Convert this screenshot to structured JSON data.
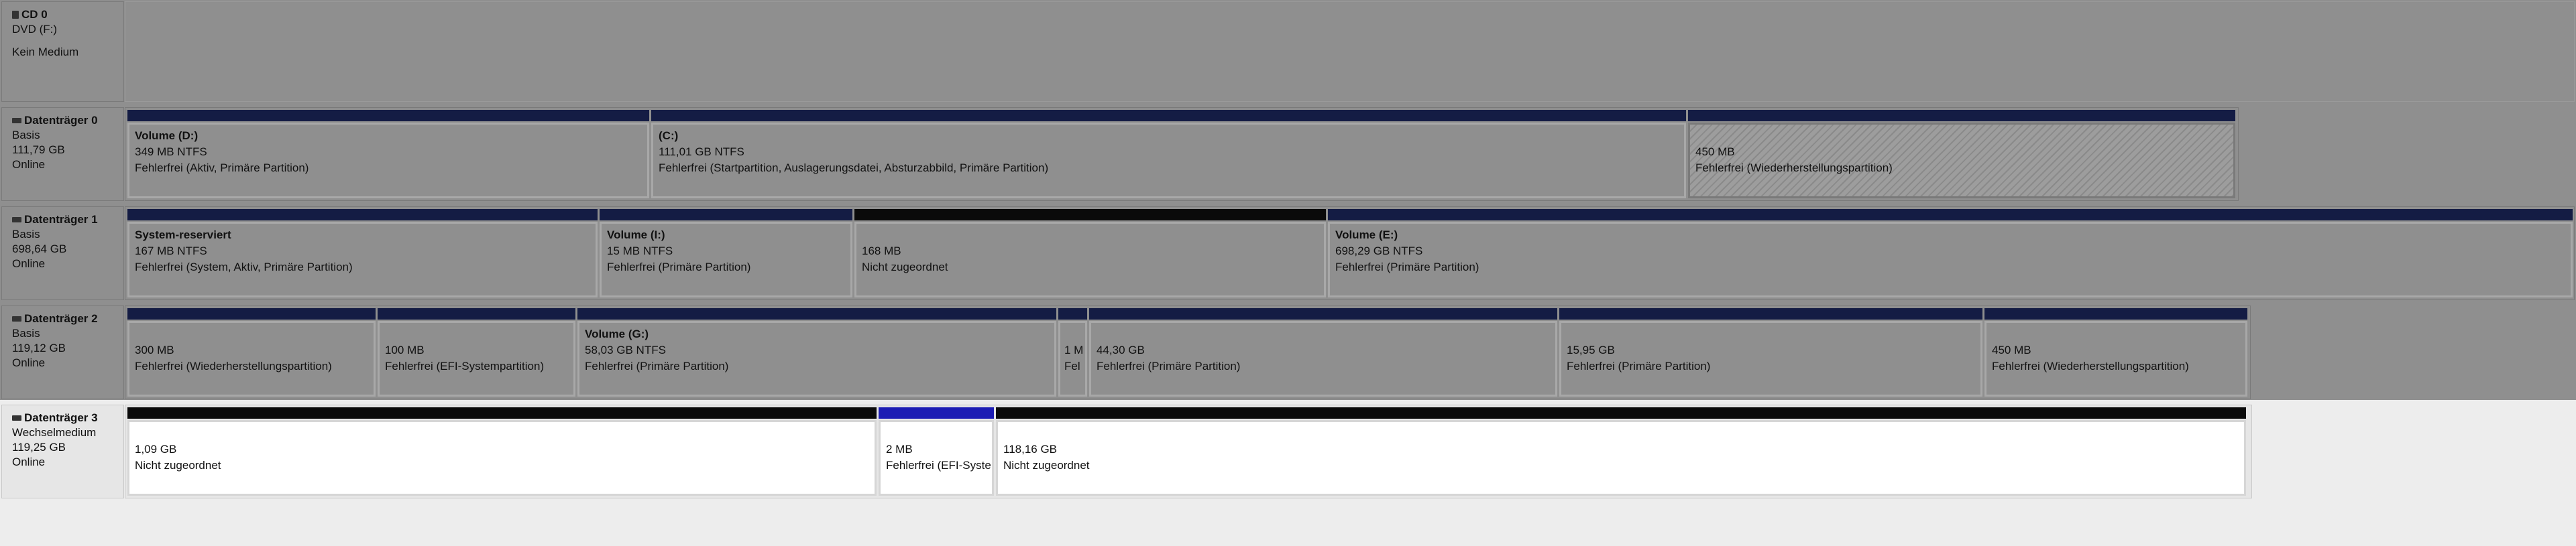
{
  "colors": {
    "primary_bar": "#141c44",
    "unallocated_bar": "#0a0a0a",
    "efi_bar": "#1d1db4"
  },
  "cd0": {
    "name": "CD 0",
    "type": "DVD (F:)",
    "status": "Kein Medium"
  },
  "disks": [
    {
      "name": "Datenträger 0",
      "type": "Basis",
      "size": "111,79 GB",
      "status": "Online",
      "partitions": [
        {
          "title": "Volume  (D:)",
          "size": "349 MB NTFS",
          "status": "Fehlerfrei (Aktiv, Primäre Partition)"
        },
        {
          "title": "(C:)",
          "size": "111,01 GB NTFS",
          "status": "Fehlerfrei (Startpartition, Auslagerungsdatei, Absturzabbild, Primäre Partition)"
        },
        {
          "title": "",
          "size": "450 MB",
          "status": "Fehlerfrei (Wiederherstellungspartition)"
        }
      ]
    },
    {
      "name": "Datenträger 1",
      "type": "Basis",
      "size": "698,64 GB",
      "status": "Online",
      "partitions": [
        {
          "title": "System-reserviert",
          "size": "167 MB NTFS",
          "status": "Fehlerfrei (System, Aktiv, Primäre Partition)"
        },
        {
          "title": "Volume  (I:)",
          "size": "15 MB NTFS",
          "status": "Fehlerfrei (Primäre Partition)"
        },
        {
          "title": "",
          "size": "168 MB",
          "status": "Nicht zugeordnet"
        },
        {
          "title": "Volume  (E:)",
          "size": "698,29 GB NTFS",
          "status": "Fehlerfrei (Primäre Partition)"
        }
      ]
    },
    {
      "name": "Datenträger 2",
      "type": "Basis",
      "size": "119,12 GB",
      "status": "Online",
      "partitions": [
        {
          "title": "",
          "size": "300 MB",
          "status": "Fehlerfrei (Wiederherstellungspartition)"
        },
        {
          "title": "",
          "size": "100 MB",
          "status": "Fehlerfrei (EFI-Systempartition)"
        },
        {
          "title": "Volume  (G:)",
          "size": "58,03 GB NTFS",
          "status": "Fehlerfrei (Primäre Partition)"
        },
        {
          "title": "",
          "size": "1 M",
          "status": "Fel"
        },
        {
          "title": "",
          "size": "44,30 GB",
          "status": "Fehlerfrei (Primäre Partition)"
        },
        {
          "title": "",
          "size": "15,95 GB",
          "status": "Fehlerfrei (Primäre Partition)"
        },
        {
          "title": "",
          "size": "450 MB",
          "status": "Fehlerfrei (Wiederherstellungspartition)"
        }
      ]
    },
    {
      "name": "Datenträger 3",
      "type": "Wechselmedium",
      "size": "119,25 GB",
      "status": "Online",
      "partitions": [
        {
          "title": "",
          "size": "1,09 GB",
          "status": "Nicht zugeordnet"
        },
        {
          "title": "",
          "size": "2 MB",
          "status": "Fehlerfrei (EFI-Syste"
        },
        {
          "title": "",
          "size": "118,16 GB",
          "status": "Nicht zugeordnet"
        }
      ]
    }
  ]
}
